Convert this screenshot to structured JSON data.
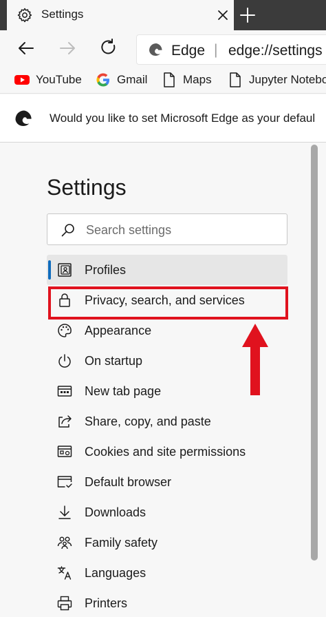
{
  "tab": {
    "title": "Settings",
    "icon": "gear-icon",
    "close_icon": "close-icon"
  },
  "newtab_icon": "plus-icon",
  "toolbar": {
    "back_icon": "back-arrow-icon",
    "forward_icon": "forward-arrow-icon",
    "refresh_icon": "refresh-icon",
    "address": {
      "site": "Edge",
      "separator": "|",
      "url": "edge://settings"
    }
  },
  "bookmarks": [
    {
      "label": "YouTube",
      "icon": "youtube-icon"
    },
    {
      "label": "Gmail",
      "icon": "google-icon"
    },
    {
      "label": "Maps",
      "icon": "page-icon"
    },
    {
      "label": "Jupyter Notebo",
      "icon": "page-icon"
    }
  ],
  "infobar": {
    "text": "Would you like to set Microsoft Edge as your defaul",
    "icon": "edge-logo-icon"
  },
  "settings": {
    "title": "Settings",
    "search_placeholder": "Search settings",
    "nav": [
      {
        "label": "Profiles",
        "icon": "profile-icon",
        "active": true
      },
      {
        "label": "Privacy, search, and services",
        "icon": "lock-icon",
        "highlighted": true
      },
      {
        "label": "Appearance",
        "icon": "palette-icon"
      },
      {
        "label": "On startup",
        "icon": "power-icon"
      },
      {
        "label": "New tab page",
        "icon": "newtab-page-icon"
      },
      {
        "label": "Share, copy, and paste",
        "icon": "share-icon"
      },
      {
        "label": "Cookies and site permissions",
        "icon": "cookies-icon"
      },
      {
        "label": "Default browser",
        "icon": "browser-icon"
      },
      {
        "label": "Downloads",
        "icon": "download-icon"
      },
      {
        "label": "Family safety",
        "icon": "family-icon"
      },
      {
        "label": "Languages",
        "icon": "languages-icon"
      },
      {
        "label": "Printers",
        "icon": "printer-icon"
      }
    ]
  },
  "colors": {
    "highlight": "#e0121e",
    "active_bar": "#0f6cbd",
    "tabstrip": "#3b3b3b"
  }
}
